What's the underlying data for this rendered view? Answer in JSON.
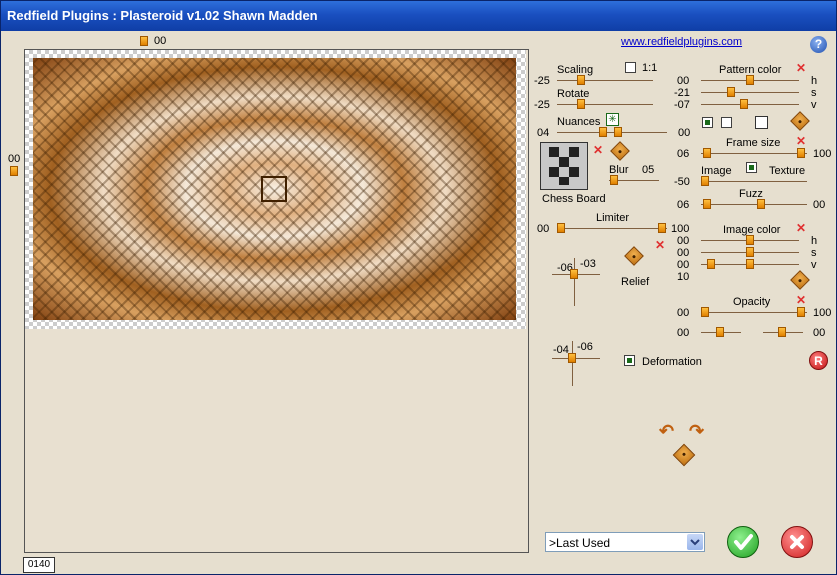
{
  "window": {
    "title": "Redfield Plugins : Plasteroid v1.02   Shawn Madden"
  },
  "link": "www.redfieldplugins.com",
  "preview": {
    "top_offset": "00",
    "left_offset": "00",
    "zoom": "0140"
  },
  "scaling": {
    "label": "Scaling",
    "value": "-25",
    "onetoone": "1:1"
  },
  "rotate": {
    "label": "Rotate",
    "value": "-25"
  },
  "nuances": {
    "label": "Nuances",
    "min": "04",
    "max": "00"
  },
  "pattern": {
    "name": "Chess Board"
  },
  "blur": {
    "label": "Blur",
    "value": "05"
  },
  "limiter": {
    "label": "Limiter",
    "min": "00",
    "max": "100"
  },
  "relief": {
    "label": "Relief",
    "x": "-06",
    "y": "-03"
  },
  "deformation": {
    "label": "Deformation",
    "x": "-04",
    "y": "-06"
  },
  "pattern_color": {
    "label": "Pattern color",
    "h": "00",
    "s": "-21",
    "v": "-07",
    "h_lbl": "h",
    "s_lbl": "s",
    "v_lbl": "v"
  },
  "frame_size": {
    "label": "Frame size",
    "min": "06",
    "max": "100"
  },
  "image_texture": {
    "image_lbl": "Image",
    "texture_lbl": "Texture",
    "value": "-50"
  },
  "fuzz": {
    "label": "Fuzz",
    "min": "06",
    "max": "00"
  },
  "image_color": {
    "label": "Image color",
    "h": "00",
    "s": "00",
    "v": "00",
    "extra": "10",
    "h_lbl": "h",
    "s_lbl": "s",
    "v_lbl": "v"
  },
  "opacity": {
    "label": "Opacity",
    "min": "00",
    "max": "100",
    "min2": "00",
    "max2": "00"
  },
  "preset": {
    "selected": ">Last Used"
  },
  "icons": {
    "help": "?",
    "reset": "R"
  }
}
